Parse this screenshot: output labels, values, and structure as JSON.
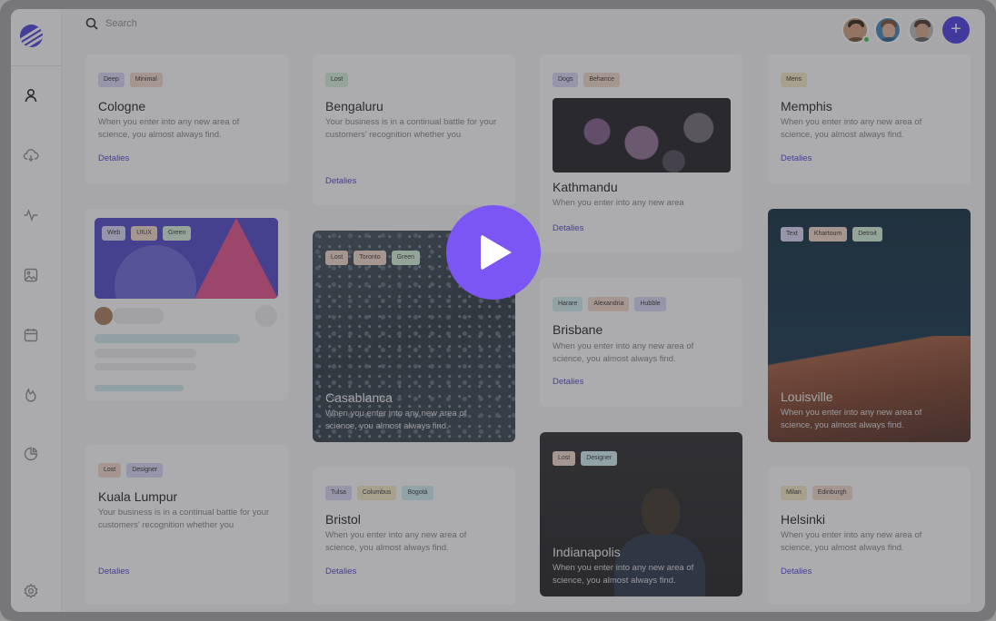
{
  "search": {
    "placeholder": "Search"
  },
  "colors": {
    "accent": "#4d40d8",
    "add_button": "#4738e3",
    "play_button": "#7c55f5",
    "online": "#36c44a"
  },
  "sidebar": {
    "items": [
      {
        "icon": "user-icon"
      },
      {
        "icon": "cloud-download-icon"
      },
      {
        "icon": "activity-icon"
      },
      {
        "icon": "image-icon"
      },
      {
        "icon": "calendar-icon"
      },
      {
        "icon": "fire-icon"
      },
      {
        "icon": "pie-chart-icon"
      },
      {
        "icon": "settings-icon"
      }
    ]
  },
  "header": {
    "add_label": "+"
  },
  "cards": {
    "cologne": {
      "tags": [
        "Deep",
        "Minimal"
      ],
      "title": "Cologne",
      "desc": "When you enter into any new area of science, you almost always find.",
      "link": "Detalies"
    },
    "bengaluru": {
      "tags": [
        "Lost"
      ],
      "title": "Bengaluru",
      "desc": "Your business is in a continual battle for your customers' recognition whether you",
      "link": "Detalies"
    },
    "kathmandu": {
      "tags": [
        "Dogs",
        "Behance"
      ],
      "title": "Kathmandu",
      "desc": "When you enter into any new area",
      "link": "Detalies"
    },
    "memphis": {
      "tags": [
        "Mens"
      ],
      "title": "Memphis",
      "desc": "When you enter into any new area of science, you almost always find.",
      "link": "Detalies"
    },
    "mockup": {
      "tags": [
        "Web",
        "UIUX",
        "Green"
      ]
    },
    "casablanca": {
      "tags": [
        "Lost",
        "Toronto",
        "Green"
      ],
      "title": "Casablanca",
      "desc": "When you enter into any new area of science, you almost always find."
    },
    "brisbane": {
      "tags": [
        "Harare",
        "Alexandria",
        "Hubble"
      ],
      "title": "Brisbane",
      "desc": "When you enter into any new area of science, you almost always find.",
      "link": "Detalies"
    },
    "louisville": {
      "tags": [
        "Text",
        "Khartoum",
        "Detroit"
      ],
      "title": "Louisville",
      "desc": "When you enter into any new area of science, you almost always find."
    },
    "kuala": {
      "tags": [
        "Lost",
        "Designer"
      ],
      "title": "Kuala Lumpur",
      "desc": "Your business is in a continual battle for your customers' recognition whether you",
      "link": "Detalies"
    },
    "bristol": {
      "tags": [
        "Tulsa",
        "Columbus",
        "Bogotá"
      ],
      "title": "Bristol",
      "desc": "When you enter into any new area of science, you almost always find.",
      "link": "Detalies"
    },
    "indianapolis": {
      "tags": [
        "Lost",
        "Designer"
      ],
      "title": "Indianapolis",
      "desc": "When you enter into any new area of science, you almost always find."
    },
    "helsinki": {
      "tags": [
        "Milan",
        "Edinburgh"
      ],
      "title": "Helsinki",
      "desc": "When you enter into any new area of science, you almost always find.",
      "link": "Detalies"
    }
  }
}
